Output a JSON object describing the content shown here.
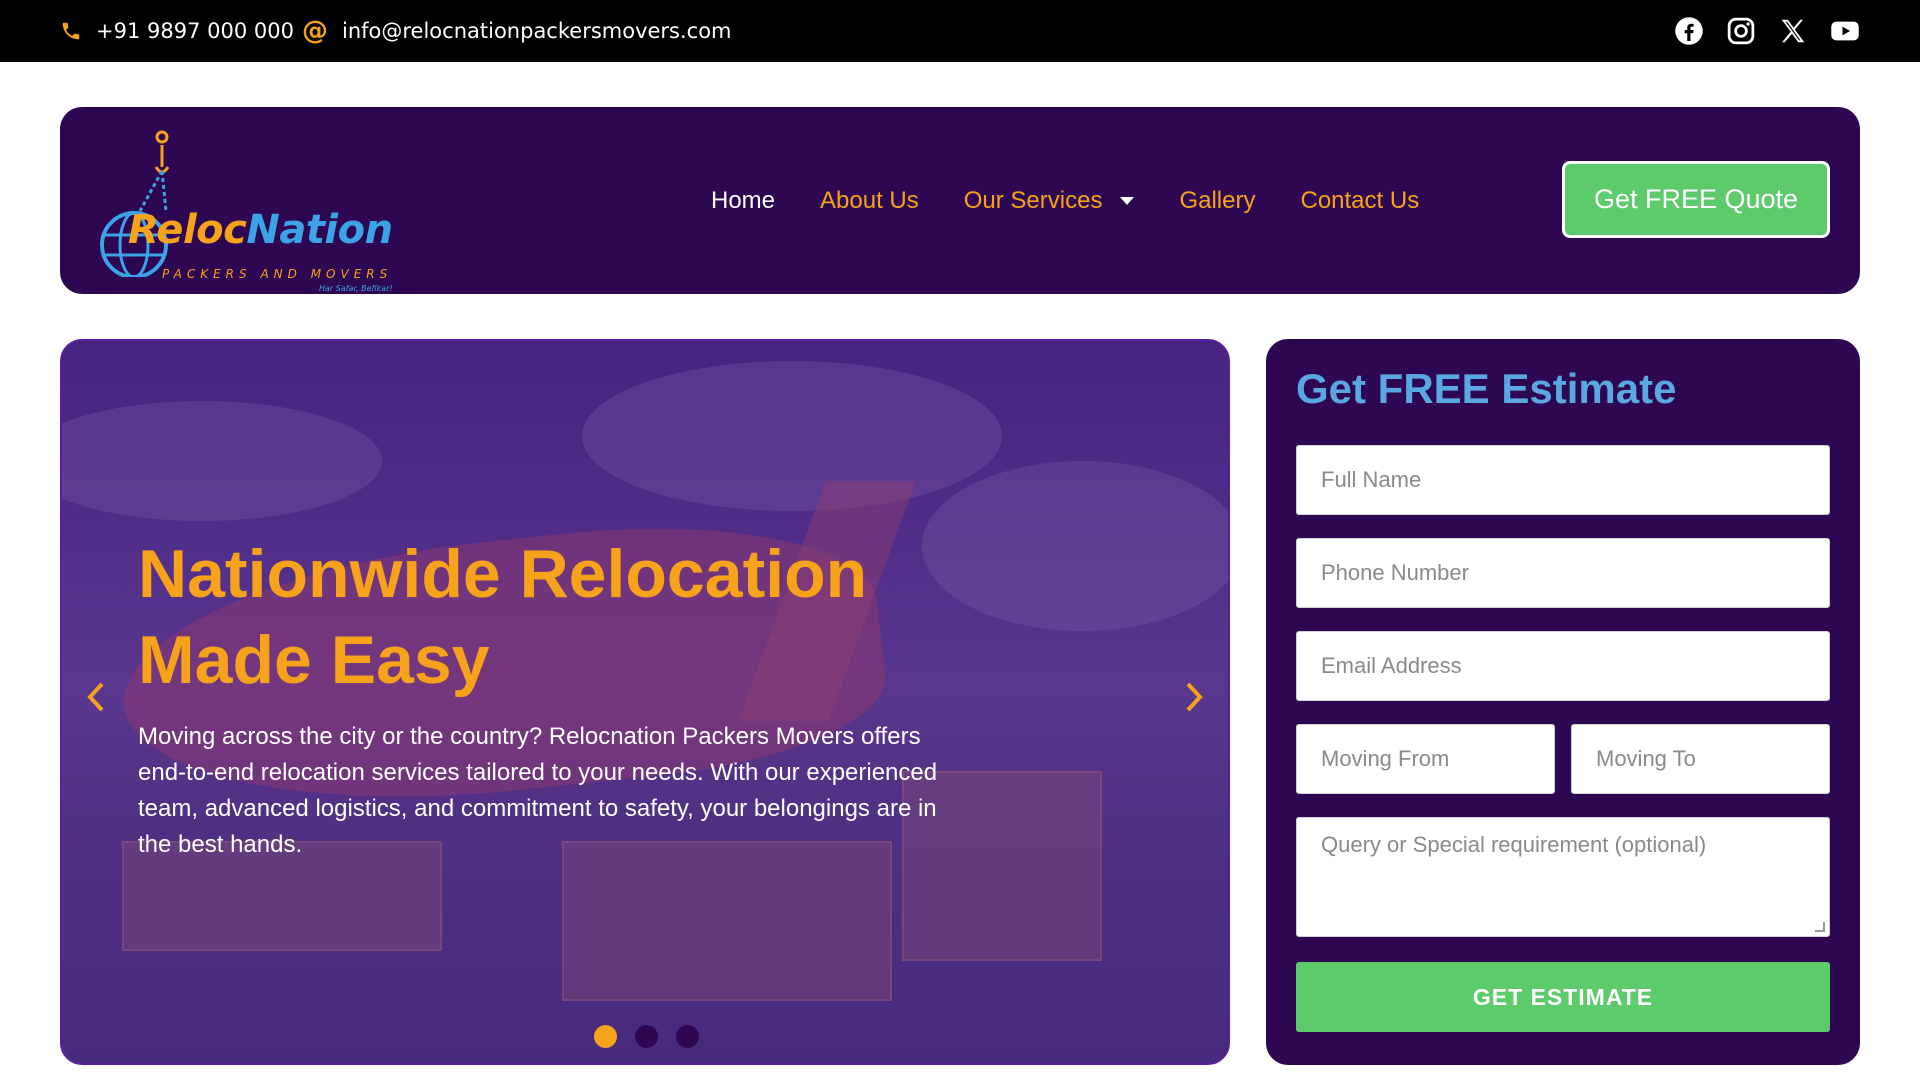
{
  "topbar": {
    "phone": "+91 9897 000 000",
    "email": "info@relocnationpackersmovers.com",
    "socials": [
      "facebook-icon",
      "instagram-icon",
      "x-icon",
      "youtube-icon"
    ]
  },
  "brand": {
    "name_part1": "Reloc",
    "name_part2": "Nation",
    "subtitle": "PACKERS AND MOVERS",
    "tagline": "Har Safar, Befikar!"
  },
  "nav": {
    "items": [
      {
        "label": "Home",
        "active": true
      },
      {
        "label": "About Us"
      },
      {
        "label": "Our Services",
        "has_dropdown": true
      },
      {
        "label": "Gallery"
      },
      {
        "label": "Contact Us"
      }
    ],
    "cta": "Get FREE Quote"
  },
  "hero": {
    "title_line1": "Nationwide Relocation",
    "title_line2": "Made Easy",
    "text": "Moving across the city or the country? Relocnation Packers Movers offers end-to-end relocation services tailored to your needs. With our experienced team, advanced logistics, and commitment to safety, your belongings are in the best hands.",
    "slides": 3,
    "active_slide": 1
  },
  "estimate": {
    "title": "Get FREE Estimate",
    "fields": {
      "full_name": "Full Name",
      "phone": "Phone Number",
      "email": "Email Address",
      "moving_from": "Moving From",
      "moving_to": "Moving To",
      "query": "Query or Special requirement (optional)"
    },
    "submit": "GET ESTIMATE"
  },
  "colors": {
    "primary": "#2d0752",
    "accent": "#f7a21b",
    "green": "#5dca6c",
    "blue": "#5aa8e2"
  }
}
